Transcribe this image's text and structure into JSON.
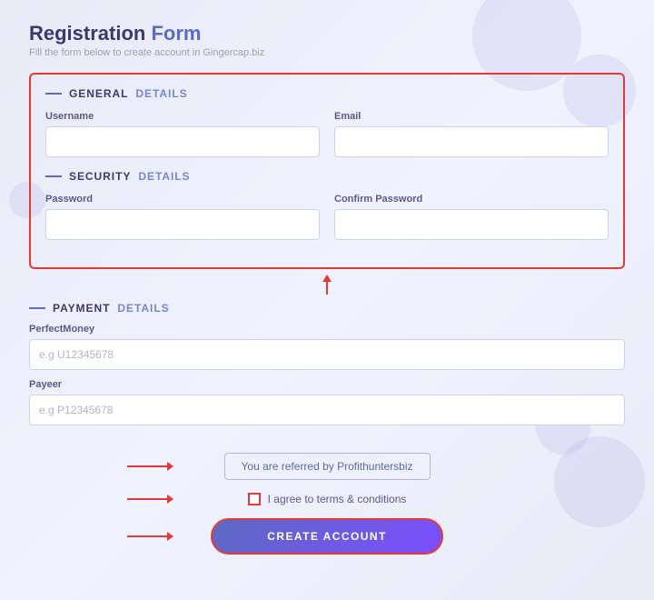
{
  "page": {
    "title_word1": "Registration",
    "title_word2": "Form",
    "subtitle": "Fill the form below to create account in Gingercap.biz"
  },
  "general_section": {
    "title_dark": "General",
    "title_blue": "Details",
    "username_label": "Username",
    "username_placeholder": "",
    "email_label": "Email",
    "email_placeholder": ""
  },
  "security_section": {
    "title_dark": "Security",
    "title_blue": "Details",
    "password_label": "Password",
    "password_placeholder": "",
    "confirm_label": "Confirm Password",
    "confirm_placeholder": ""
  },
  "payment_section": {
    "title_dark": "Payment",
    "title_blue": "Details",
    "perfectmoney_label": "PerfectMoney",
    "perfectmoney_placeholder": "e.g U12345678",
    "payeer_label": "Payeer",
    "payeer_placeholder": "e.g P12345678"
  },
  "referral": {
    "text": "You are referred by Profithuntersbiz"
  },
  "terms": {
    "label": "I agree to terms & conditions"
  },
  "submit": {
    "label": "CREATE ACCOUNT"
  }
}
